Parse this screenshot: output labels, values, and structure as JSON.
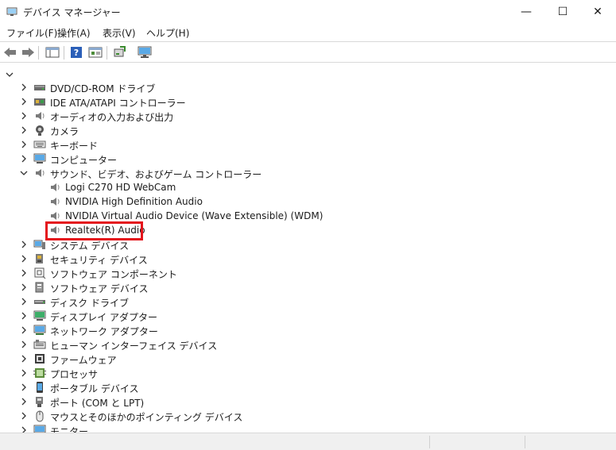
{
  "window": {
    "title": "デバイス マネージャー",
    "minimize_glyph": "—",
    "maximize_glyph": "☐",
    "close_glyph": "✕"
  },
  "menu": {
    "items": [
      "ファイル(F)",
      "操作(A)",
      "表示(V)",
      "ヘルプ(H)"
    ]
  },
  "toolbar": {
    "buttons": [
      "back-arrow-icon",
      "forward-arrow-icon",
      "show-hide-tree-icon",
      "help-icon",
      "properties-icon",
      "update-driver-icon",
      "scan-hardware-icon"
    ]
  },
  "tree": {
    "root_expanded": true,
    "categories": [
      {
        "label": "DVD/CD-ROM ドライブ",
        "icon": "dvd-drive-icon",
        "expanded": false
      },
      {
        "label": "IDE ATA/ATAPI コントローラー",
        "icon": "ide-controller-icon",
        "expanded": false
      },
      {
        "label": "オーディオの入力および出力",
        "icon": "speaker-icon",
        "expanded": false
      },
      {
        "label": "カメラ",
        "icon": "camera-icon",
        "expanded": false
      },
      {
        "label": "キーボード",
        "icon": "keyboard-icon",
        "expanded": false
      },
      {
        "label": "コンピューター",
        "icon": "computer-icon",
        "expanded": false
      },
      {
        "label": "サウンド、ビデオ、およびゲーム コントローラー",
        "icon": "speaker-icon",
        "expanded": true,
        "children": [
          {
            "label": "Logi C270 HD WebCam",
            "icon": "speaker-icon"
          },
          {
            "label": "NVIDIA High Definition Audio",
            "icon": "speaker-icon"
          },
          {
            "label": "NVIDIA Virtual Audio Device (Wave Extensible) (WDM)",
            "icon": "speaker-icon"
          },
          {
            "label": "Realtek(R) Audio",
            "icon": "speaker-icon",
            "highlighted": true
          }
        ]
      },
      {
        "label": "システム デバイス",
        "icon": "system-device-icon",
        "expanded": false
      },
      {
        "label": "セキュリティ デバイス",
        "icon": "security-device-icon",
        "expanded": false
      },
      {
        "label": "ソフトウェア コンポーネント",
        "icon": "software-component-icon",
        "expanded": false
      },
      {
        "label": "ソフトウェア デバイス",
        "icon": "software-device-icon",
        "expanded": false
      },
      {
        "label": "ディスク ドライブ",
        "icon": "disk-drive-icon",
        "expanded": false
      },
      {
        "label": "ディスプレイ アダプター",
        "icon": "display-adapter-icon",
        "expanded": false
      },
      {
        "label": "ネットワーク アダプター",
        "icon": "network-adapter-icon",
        "expanded": false
      },
      {
        "label": "ヒューマン インターフェイス デバイス",
        "icon": "hid-icon",
        "expanded": false
      },
      {
        "label": "ファームウェア",
        "icon": "firmware-icon",
        "expanded": false
      },
      {
        "label": "プロセッサ",
        "icon": "processor-icon",
        "expanded": false
      },
      {
        "label": "ポータブル デバイス",
        "icon": "portable-device-icon",
        "expanded": false
      },
      {
        "label": "ポート (COM と LPT)",
        "icon": "port-icon",
        "expanded": false
      },
      {
        "label": "マウスとそのほかのポインティング デバイス",
        "icon": "mouse-icon",
        "expanded": false
      },
      {
        "label": "モニター",
        "icon": "monitor-icon",
        "expanded": false
      }
    ]
  },
  "colors": {
    "highlight": "#e4141c",
    "toolbar_blue": "#2b6cc4",
    "icon_gray": "#6b6b6b"
  }
}
